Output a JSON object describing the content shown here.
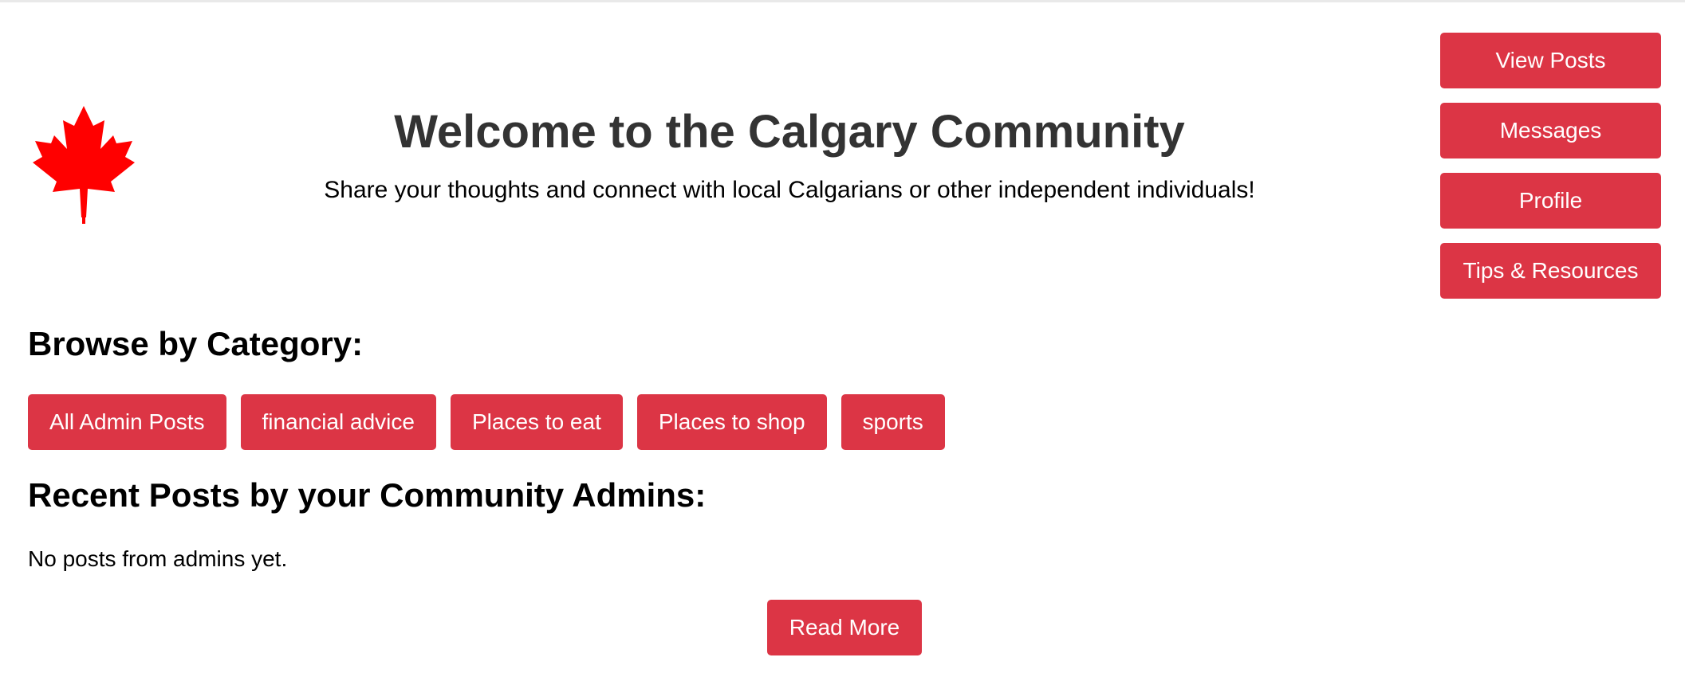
{
  "header": {
    "title": "Welcome to the Calgary Community",
    "subtitle": "Share your thoughts and connect with local Calgarians or other independent individuals!",
    "logo_icon": "maple-leaf-icon"
  },
  "nav": {
    "items": [
      {
        "label": "View Posts"
      },
      {
        "label": "Messages"
      },
      {
        "label": "Profile"
      },
      {
        "label": "Tips & Resources"
      }
    ]
  },
  "categories": {
    "heading": "Browse by Category:",
    "items": [
      {
        "label": "All Admin Posts"
      },
      {
        "label": "financial advice"
      },
      {
        "label": "Places to eat"
      },
      {
        "label": "Places to shop"
      },
      {
        "label": "sports"
      }
    ]
  },
  "admin_posts": {
    "heading": "Recent Posts by your Community Admins:",
    "empty_message": "No posts from admins yet.",
    "read_more_label": "Read More"
  },
  "colors": {
    "accent": "#dc3545",
    "logo_red": "#ff0000",
    "title_text": "#333333"
  }
}
